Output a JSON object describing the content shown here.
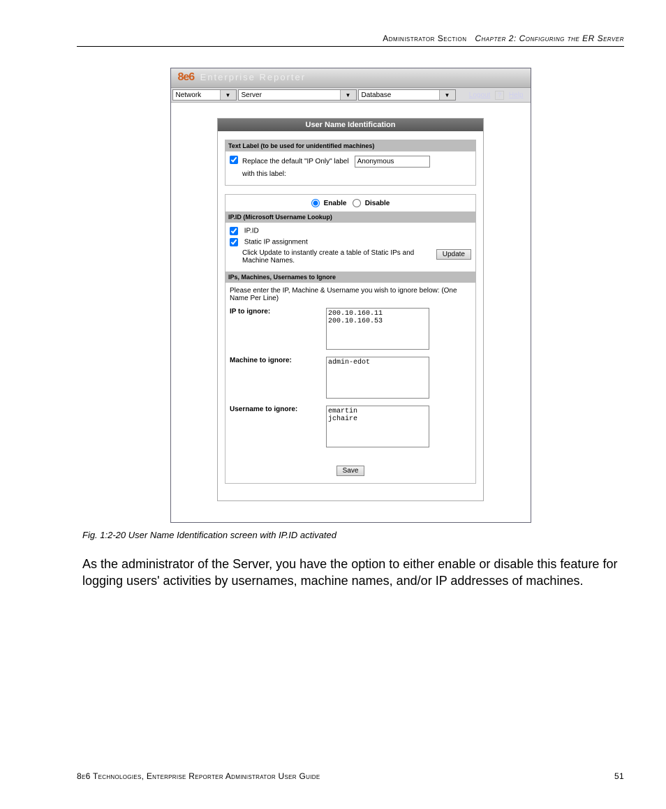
{
  "header": {
    "section": "Administrator Section",
    "chapter": "Chapter 2: Configuring the ER Server"
  },
  "brand": {
    "logo": "8e6",
    "product": "Enterprise Reporter"
  },
  "menubar": {
    "menu1": "Network",
    "menu2": "Server",
    "menu3": "Database",
    "logout": "Logout",
    "help_q": "?",
    "help": "Help"
  },
  "panel": {
    "title": "User Name Identification",
    "textlabel": {
      "header": "Text Label (to be used for unidentified machines)",
      "checkbox_checked": true,
      "line1": "Replace the default \"IP Only\" label",
      "line2": "with this label:",
      "value": "Anonymous"
    },
    "toggle": {
      "enable": "Enable",
      "disable": "Disable",
      "selected": "enable"
    },
    "ipid": {
      "header": "IP.ID (Microsoft Username Lookup)",
      "opt1": "IP.ID",
      "opt1_checked": true,
      "opt2": "Static IP assignment",
      "opt2_checked": true,
      "update_hint": "Click Update to instantly create a table of Static IPs and Machine Names.",
      "update_btn": "Update"
    },
    "ignore": {
      "header": "IPs, Machines, Usernames to Ignore",
      "instr": "Please enter the IP, Machine & Username you wish to ignore below: (One Name Per Line)",
      "ip_label": "IP to ignore:",
      "ip_value": "200.10.160.11\n200.10.160.53",
      "machine_label": "Machine to ignore:",
      "machine_value": "admin-edot",
      "user_label": "Username to ignore:",
      "user_value": "emartin\njchaire"
    },
    "save": "Save"
  },
  "caption": "Fig. 1:2-20  User Name Identification screen with IP.ID activated",
  "bodytext": "As the administrator of the Server, you have the option to either enable or disable this feature for logging users' activities by usernames, machine names, and/or IP addresses of machines.",
  "footer": {
    "left": "8e6 Technologies, Enterprise Reporter Administrator User Guide",
    "page": "51"
  }
}
